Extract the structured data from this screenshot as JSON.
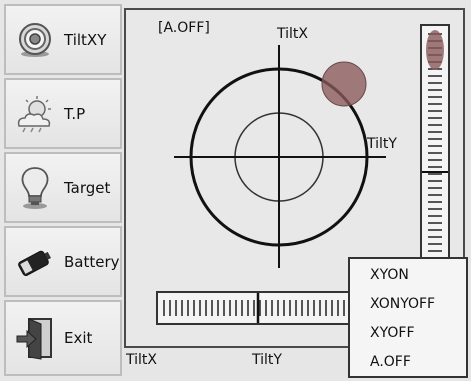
{
  "sidebar": {
    "items": [
      {
        "label": "TiltXY",
        "icon": "target-icon"
      },
      {
        "label": "T.P",
        "icon": "weather-icon"
      },
      {
        "label": "Target",
        "icon": "lightbulb-icon"
      },
      {
        "label": "Battery",
        "icon": "battery-icon"
      },
      {
        "label": "Exit",
        "icon": "exit-door-icon"
      }
    ]
  },
  "main": {
    "mode_label": "[A.OFF]",
    "axis_tiltx": "TiltX",
    "axis_tilty": "TiltY",
    "bottom_tiltx": "TiltX",
    "bottom_tilty": "TiltY"
  },
  "menu": {
    "items": [
      "XYON",
      "XONYOFF",
      "XYOFF",
      "A.OFF"
    ]
  },
  "colors": {
    "indicator": "#8a5a5a",
    "frame": "#333333",
    "background": "#e8e8e8"
  }
}
